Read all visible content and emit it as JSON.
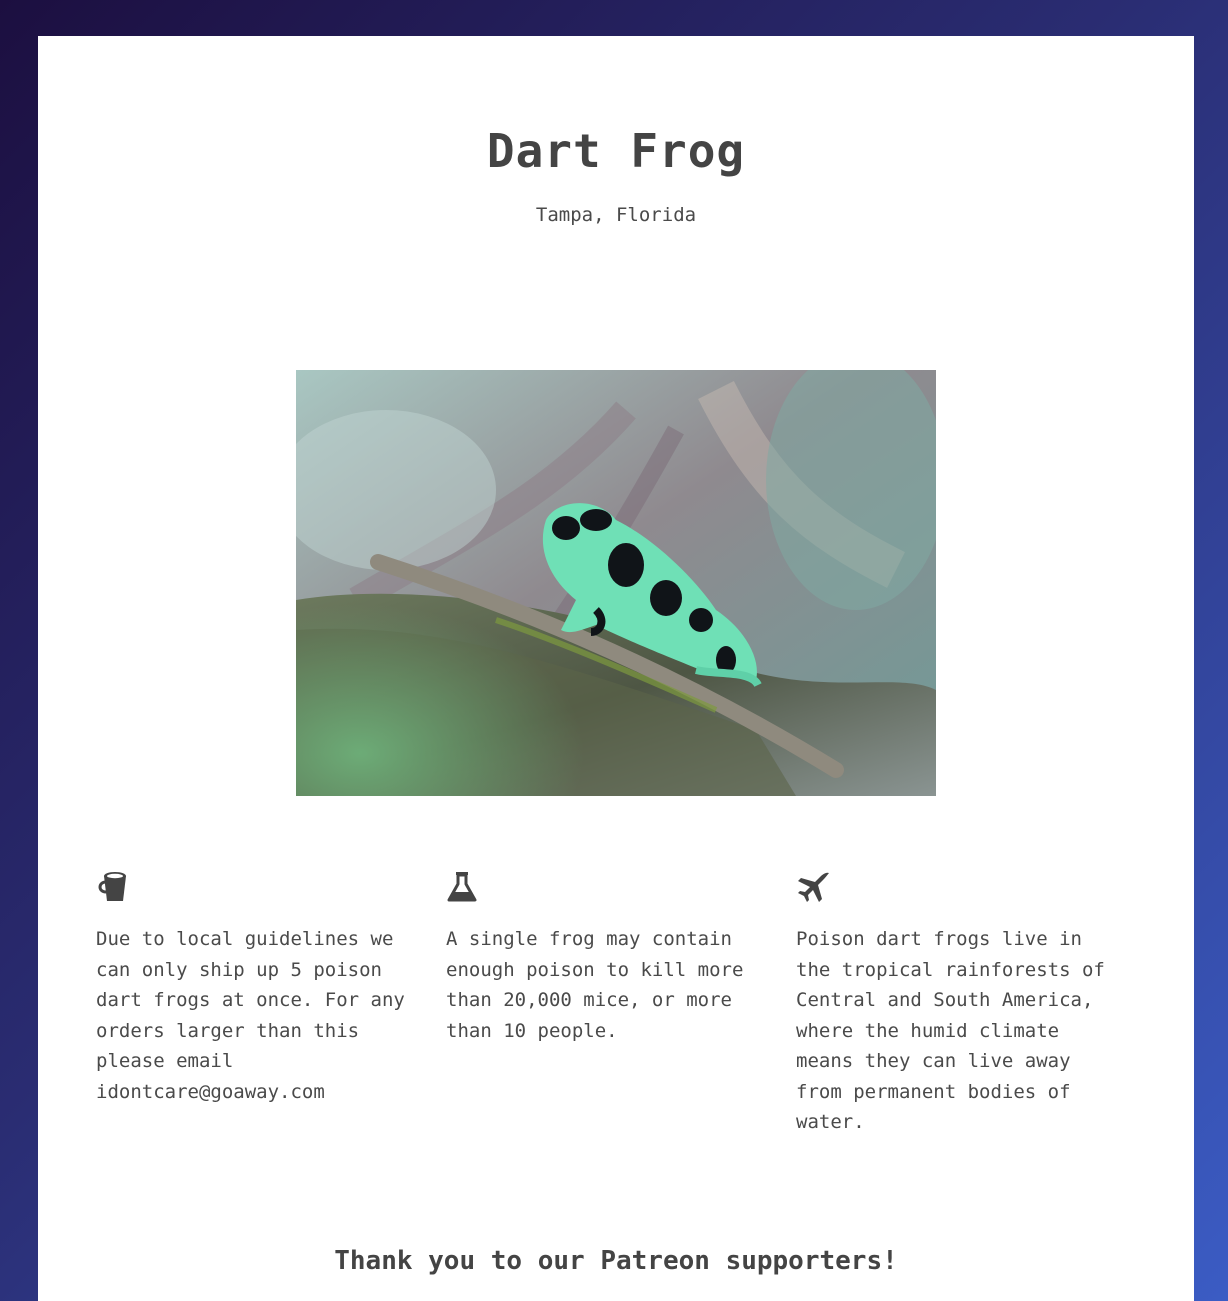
{
  "page": {
    "title": "Dart Frog",
    "location": "Tampa, Florida"
  },
  "hero_image": {
    "subject": "green and black poison dart frog on a mossy branch"
  },
  "features": [
    {
      "icon": "bucket-icon",
      "text": "Due to local guidelines we can only ship up 5 poison dart frogs at once. For any orders larger than this please email idontcare@goaway.com"
    },
    {
      "icon": "flask-icon",
      "text": "A single frog may contain enough poison to kill more than 20,000 mice, or more than 10 people."
    },
    {
      "icon": "plane-icon",
      "text": "Poison dart frogs live in the tropical rainforests of Central and South America, where the humid climate means they can live away from permanent bodies of water."
    }
  ],
  "footer": {
    "thanks": "Thank you to our Patreon supporters!"
  },
  "colors": {
    "text": "#4a4a4a",
    "card": "#ffffff",
    "gradient_start": "#1c0f40",
    "gradient_end": "#3b5cc4"
  }
}
